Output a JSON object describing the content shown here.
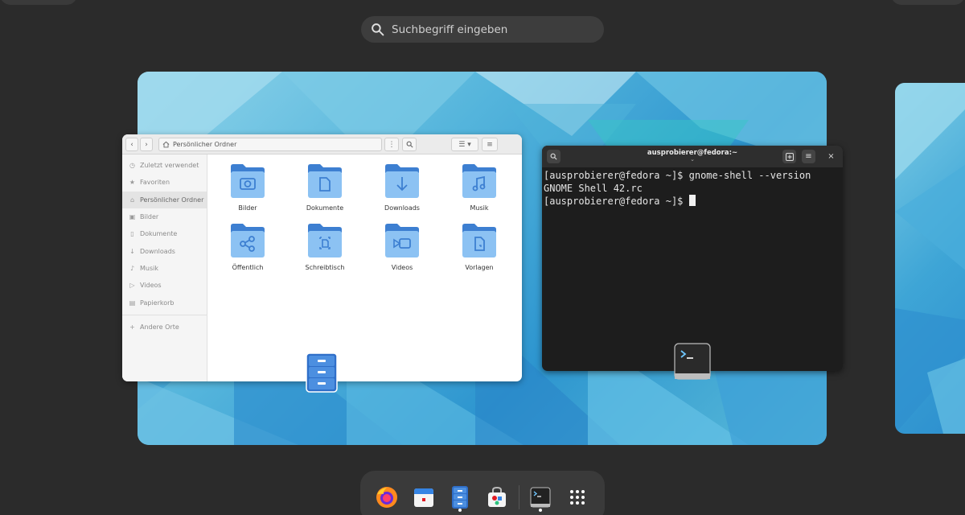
{
  "search": {
    "placeholder": "Suchbegriff eingeben"
  },
  "files": {
    "path": "Persönlicher Ordner",
    "sidebar": [
      {
        "label": "Zuletzt verwendet",
        "icon": "clock-icon"
      },
      {
        "label": "Favoriten",
        "icon": "star-icon"
      },
      {
        "label": "Persönlicher Ordner",
        "icon": "home-icon",
        "active": true
      },
      {
        "label": "Bilder",
        "icon": "image-icon"
      },
      {
        "label": "Dokumente",
        "icon": "document-icon"
      },
      {
        "label": "Downloads",
        "icon": "download-icon"
      },
      {
        "label": "Musik",
        "icon": "music-icon"
      },
      {
        "label": "Videos",
        "icon": "video-icon"
      },
      {
        "label": "Papierkorb",
        "icon": "trash-icon"
      },
      {
        "label": "Andere Orte",
        "icon": "plus-icon"
      }
    ],
    "folders": [
      {
        "label": "Bilder",
        "icon": "camera-icon"
      },
      {
        "label": "Dokumente",
        "icon": "document-icon"
      },
      {
        "label": "Downloads",
        "icon": "download-icon"
      },
      {
        "label": "Musik",
        "icon": "music-icon"
      },
      {
        "label": "Öffentlich",
        "icon": "share-icon"
      },
      {
        "label": "Schreibtisch",
        "icon": "desktop-icon"
      },
      {
        "label": "Videos",
        "icon": "video-icon"
      },
      {
        "label": "Vorlagen",
        "icon": "template-icon"
      }
    ]
  },
  "terminal": {
    "title": "ausprobierer@fedora:~",
    "lines": [
      "[ausprobierer@fedora ~]$ gnome-shell --version",
      "GNOME Shell 42.rc",
      "[ausprobierer@fedora ~]$ "
    ]
  },
  "dock": {
    "items": [
      {
        "name": "firefox",
        "running": false
      },
      {
        "name": "calendar",
        "running": false
      },
      {
        "name": "files",
        "running": true
      },
      {
        "name": "software",
        "running": false
      },
      {
        "name": "terminal",
        "running": true
      },
      {
        "name": "app-grid",
        "running": false
      }
    ]
  },
  "colors": {
    "accent": "#3584e4",
    "folder": "#4a90d9",
    "folder_light": "#8cc2f3"
  }
}
